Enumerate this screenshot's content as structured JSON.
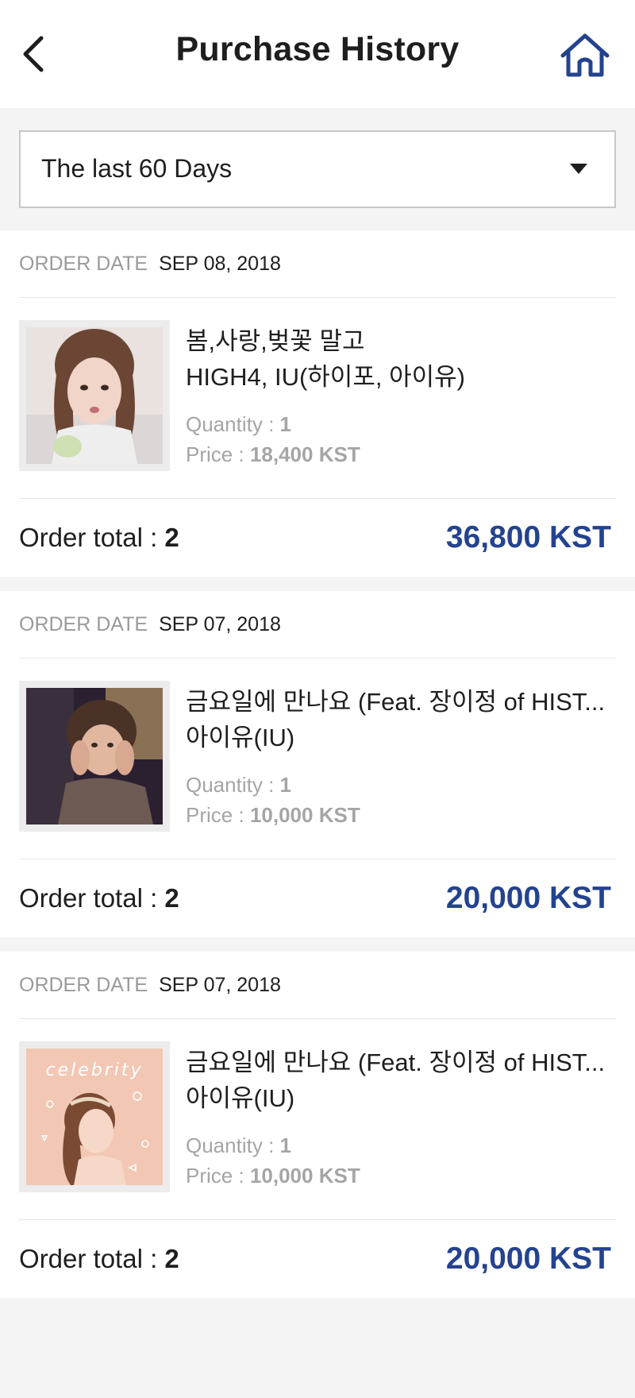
{
  "header": {
    "title": "Purchase History",
    "back_icon": "chevron-left-icon",
    "home_icon": "home-icon"
  },
  "filter": {
    "selected": "The last 60 Days"
  },
  "labels": {
    "order_date": "ORDER DATE",
    "quantity": "Quantity",
    "price": "Price",
    "order_total": "Order total",
    "separator": ":"
  },
  "colors": {
    "accent": "#24438f",
    "muted": "#a5a5a5"
  },
  "orders": [
    {
      "date": "SEP 08, 2018",
      "title": "봄,사랑,벚꽃 말고",
      "artist": "HIGH4, IU(하이포, 아이유)",
      "quantity": "1",
      "price": "18,400 KST",
      "total_count": "2",
      "total_price": "36,800 KST"
    },
    {
      "date": "SEP 07, 2018",
      "title": "금요일에 만나요 (Feat. 장이정 of HIST...",
      "artist": "아이유(IU)",
      "quantity": "1",
      "price": "10,000 KST",
      "total_count": "2",
      "total_price": "20,000 KST"
    },
    {
      "date": "SEP 07, 2018",
      "title": "금요일에 만나요 (Feat. 장이정 of HIST...",
      "artist": "아이유(IU)",
      "quantity": "1",
      "price": "10,000 KST",
      "total_count": "2",
      "total_price": "20,000 KST",
      "cover_text": "celebrity"
    }
  ]
}
